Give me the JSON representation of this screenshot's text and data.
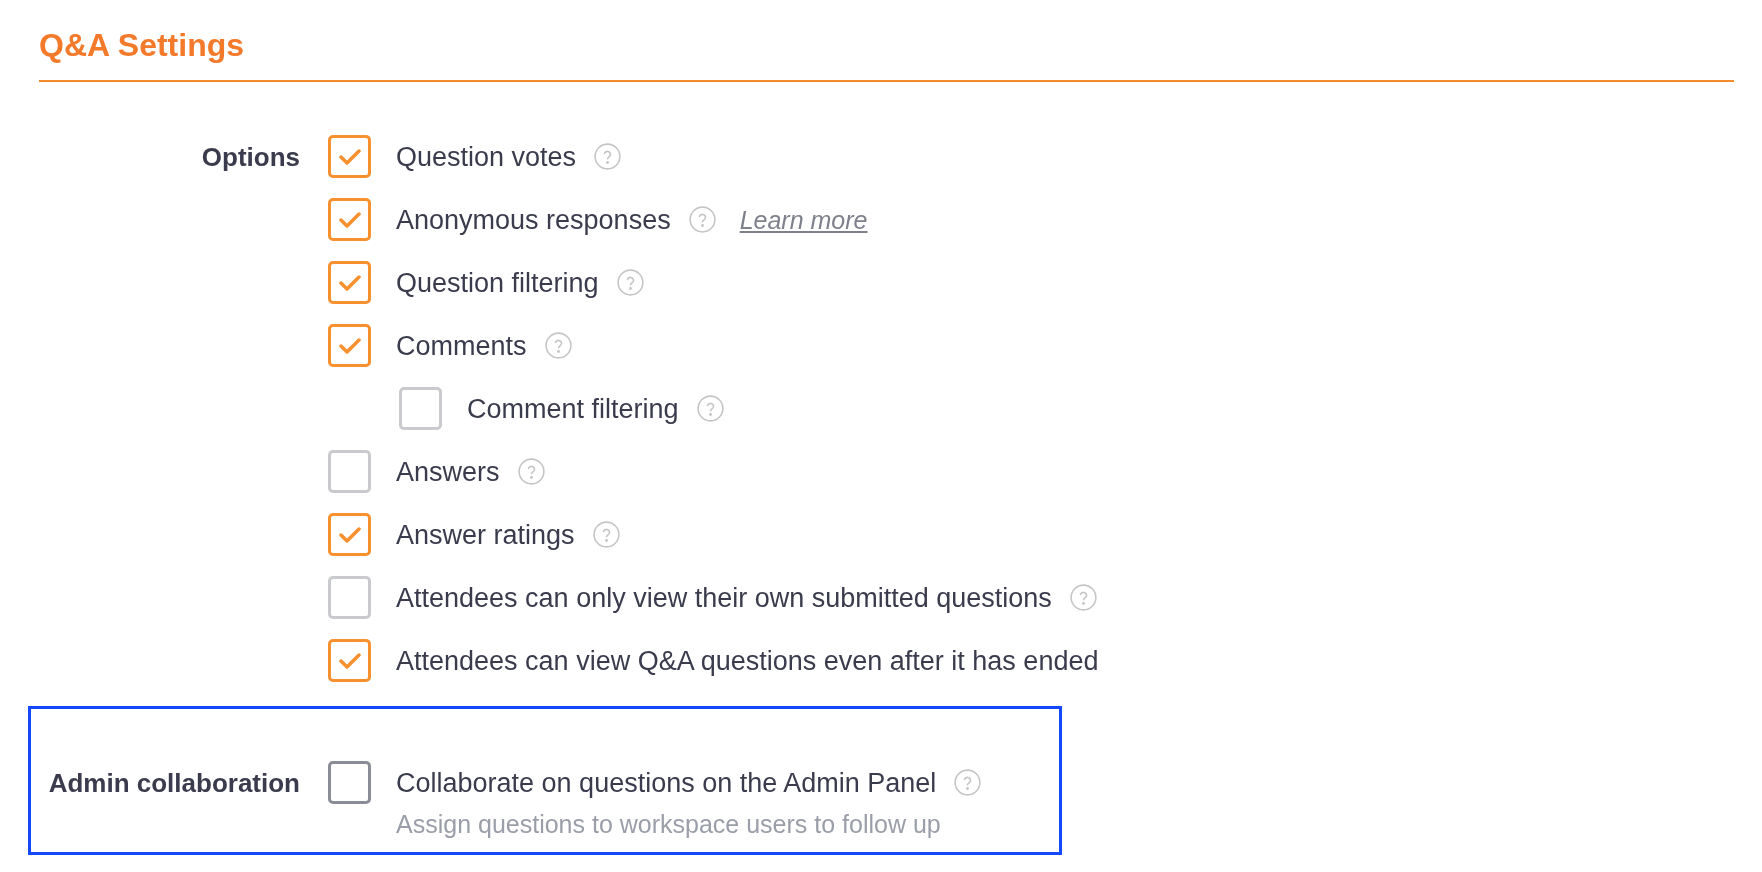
{
  "title": "Q&A Settings",
  "sections": [
    {
      "label": "Options",
      "highlighted": false,
      "options": [
        {
          "label": "Question votes",
          "checked": true,
          "focused": false,
          "help": true
        },
        {
          "label": "Anonymous responses",
          "checked": true,
          "focused": false,
          "help": true,
          "link": "Learn more"
        },
        {
          "label": "Question filtering",
          "checked": true,
          "focused": false,
          "help": true
        },
        {
          "label": "Comments",
          "checked": true,
          "focused": false,
          "help": true,
          "children": [
            {
              "label": "Comment filtering",
              "checked": false,
              "focused": false,
              "help": true
            }
          ]
        },
        {
          "label": "Answers",
          "checked": false,
          "focused": false,
          "help": true
        },
        {
          "label": "Answer ratings",
          "checked": true,
          "focused": false,
          "help": true
        },
        {
          "label": "Attendees can only view their own submitted questions",
          "checked": false,
          "focused": false,
          "help": true
        },
        {
          "label": "Attendees can view Q&A questions even after it has ended",
          "checked": true,
          "focused": false,
          "help": false
        }
      ]
    },
    {
      "label": "Admin collaboration",
      "highlighted": true,
      "options": [
        {
          "label": "Collaborate on questions on the Admin Panel",
          "checked": false,
          "focused": true,
          "help": true,
          "description": "Assign questions to workspace users to follow up"
        }
      ]
    }
  ]
}
